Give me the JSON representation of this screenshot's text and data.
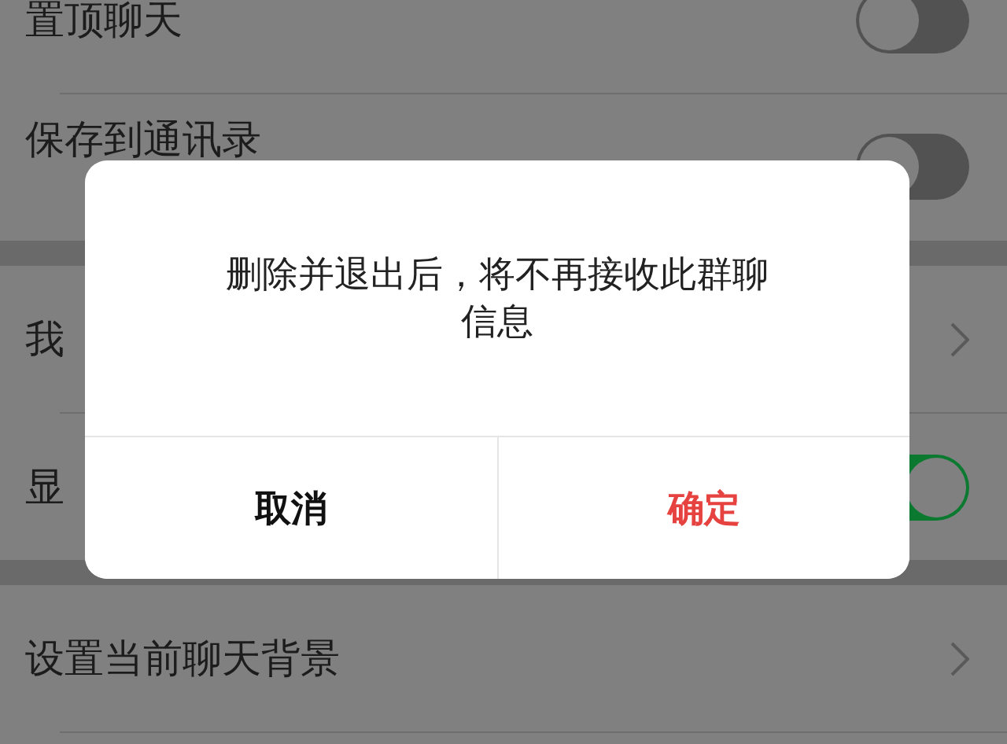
{
  "settings": [
    {
      "label": "置顶聊天",
      "kind": "toggle",
      "on": false,
      "group_end": false
    },
    {
      "label": "保存到通讯录",
      "kind": "toggle",
      "on": false,
      "group_end": true
    },
    {
      "label": "我",
      "kind": "link",
      "group_end": false
    },
    {
      "label": "显",
      "kind": "toggle",
      "on": true,
      "group_end": true
    },
    {
      "label": "设置当前聊天背景",
      "kind": "link",
      "group_end": false
    }
  ],
  "dialog": {
    "message": "删除并退出后，将不再接收此群聊信息",
    "buttons": [
      {
        "label": "取消",
        "kind": "cancel"
      },
      {
        "label": "确定",
        "kind": "confirm"
      }
    ]
  }
}
